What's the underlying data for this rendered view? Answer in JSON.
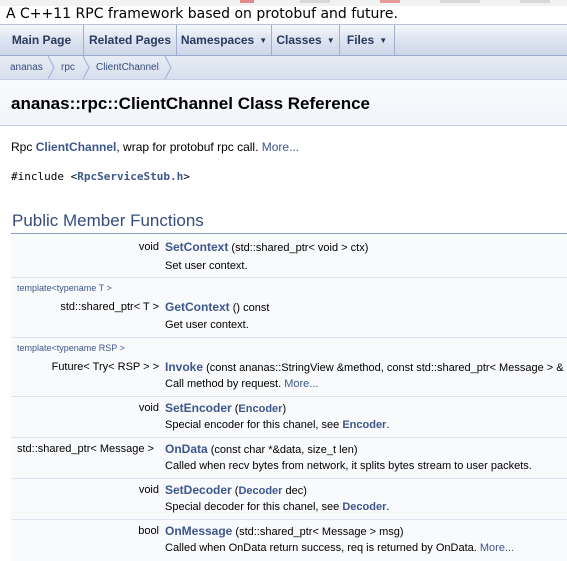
{
  "project": {
    "brief": "A C++11 RPC framework based on protobuf and future."
  },
  "nav": {
    "items": [
      {
        "label": "Main Page"
      },
      {
        "label": "Related Pages"
      },
      {
        "label": "Namespaces",
        "dropdown": true
      },
      {
        "label": "Classes",
        "dropdown": true
      },
      {
        "label": "Files",
        "dropdown": true
      }
    ]
  },
  "breadcrumb": [
    "ananas",
    "rpc",
    "ClientChannel"
  ],
  "header": {
    "title": "ananas::rpc::ClientChannel Class Reference"
  },
  "brief": {
    "prefix": "Rpc ",
    "class_link": "ClientChannel",
    "text": ", wrap for protobuf rpc call. ",
    "more": "More..."
  },
  "include": {
    "directive": "#include <",
    "file": "RpcServiceStub.h",
    "close": ">"
  },
  "section": {
    "title": "Public Member Functions"
  },
  "members": [
    {
      "template": "",
      "return_type": "void",
      "name": "SetContext",
      "args_before": " (std::shared_ptr< void > ctx)",
      "arg_link": "",
      "args_after": "",
      "desc": "Set user context.",
      "desc_link": "",
      "desc_after": ""
    },
    {
      "template": "template<typename T >",
      "return_type": "std::shared_ptr< T >",
      "name": "GetContext",
      "args_before": " () const",
      "arg_link": "",
      "args_after": "",
      "desc": "Get user context.",
      "desc_link": "",
      "desc_after": ""
    },
    {
      "template": "template<typename RSP >",
      "return_type": "Future< Try< RSP > >",
      "name": "Invoke",
      "args_before": " (const ananas::StringView &method, const std::shared_ptr< Message > &",
      "arg_link": "",
      "args_after": "",
      "desc": "Call method by request. ",
      "desc_link": "More...",
      "desc_after": ""
    },
    {
      "template": "",
      "return_type": "void",
      "name": "SetEncoder",
      "args_before": " (",
      "arg_link": "Encoder",
      "args_after": ")",
      "desc": "Special encoder for this chanel, see ",
      "desc_link": "Encoder",
      "desc_after": "."
    },
    {
      "template": "",
      "return_type": "std::shared_ptr< Message >",
      "name": "OnData",
      "args_before": " (const char *&data, size_t len)",
      "arg_link": "",
      "args_after": "",
      "desc": "Called when recv bytes from network, it splits bytes stream to user packets.",
      "desc_link": "",
      "desc_after": ""
    },
    {
      "template": "",
      "return_type": "void",
      "name": "SetDecoder",
      "args_before": " (",
      "arg_link": "Decoder",
      "args_after": " dec)",
      "desc": "Special decoder for this chanel, see ",
      "desc_link": "Decoder",
      "desc_after": "."
    },
    {
      "template": "",
      "return_type": "bool",
      "name": "OnMessage",
      "args_before": " (std::shared_ptr< Message > msg)",
      "arg_link": "",
      "args_after": "",
      "desc": "Called when OnData return success, req is returned by OnData. ",
      "desc_link": "More...",
      "desc_after": ""
    }
  ],
  "colors": {
    "link": "#3d578c",
    "section_title": "#354c7b",
    "nav_text": "#283a5d"
  }
}
